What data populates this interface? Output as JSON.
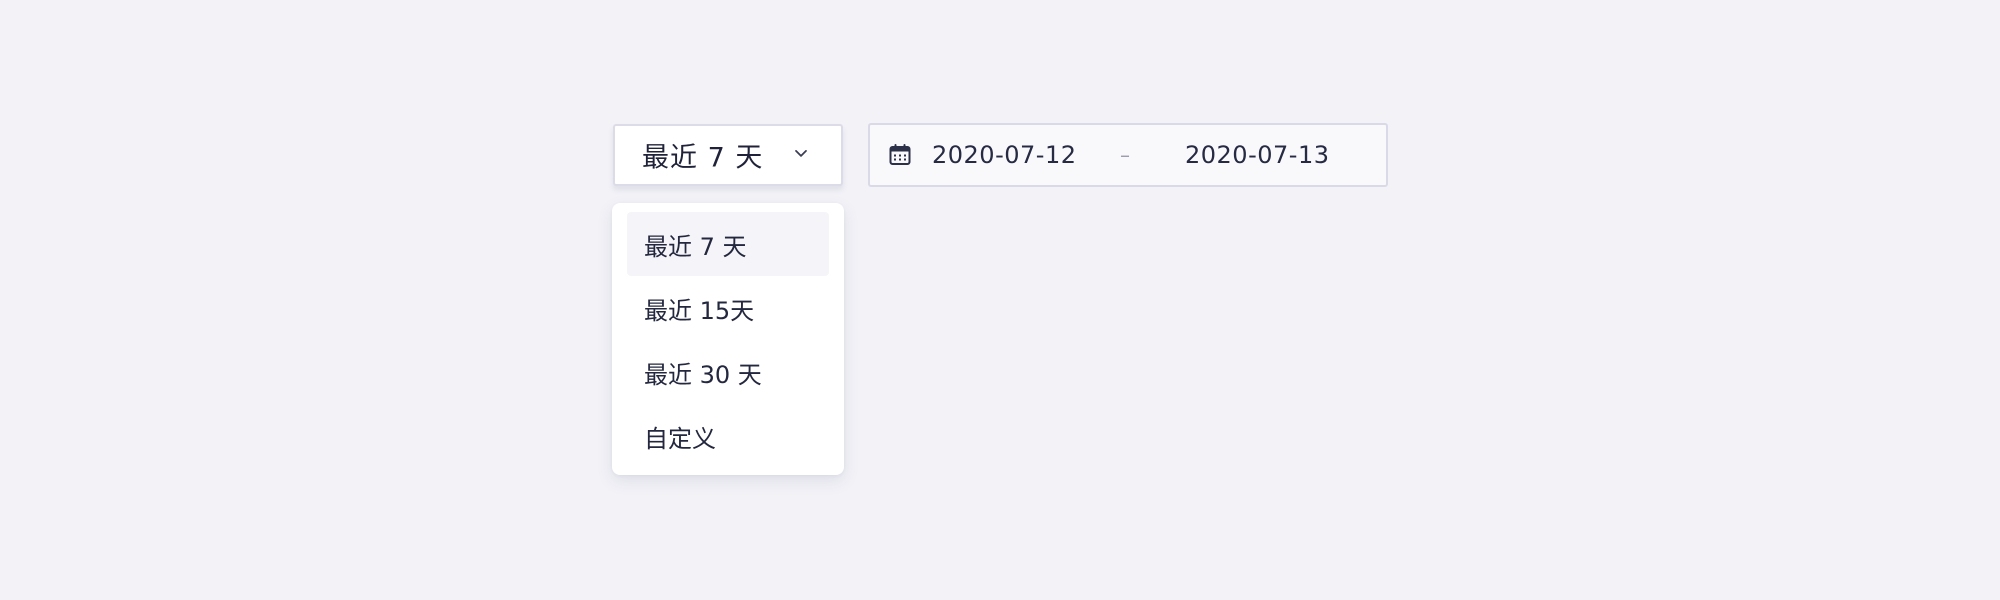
{
  "select": {
    "value": "最近 7 天",
    "icon": "chevron-down-icon"
  },
  "range": {
    "icon": "calendar-icon",
    "start": "2020-07-12",
    "separator": "–",
    "end": "2020-07-13"
  },
  "menu": {
    "items": [
      {
        "label": "最近 7 天",
        "selected": true
      },
      {
        "label": "最近 15天",
        "selected": false
      },
      {
        "label": "最近 30 天",
        "selected": false
      },
      {
        "label": "自定义",
        "selected": false
      }
    ]
  },
  "colors": {
    "background": "#f2f2f7",
    "text": "#1f2238",
    "border": "#dcdce8",
    "hover": "#f5f5f9"
  }
}
